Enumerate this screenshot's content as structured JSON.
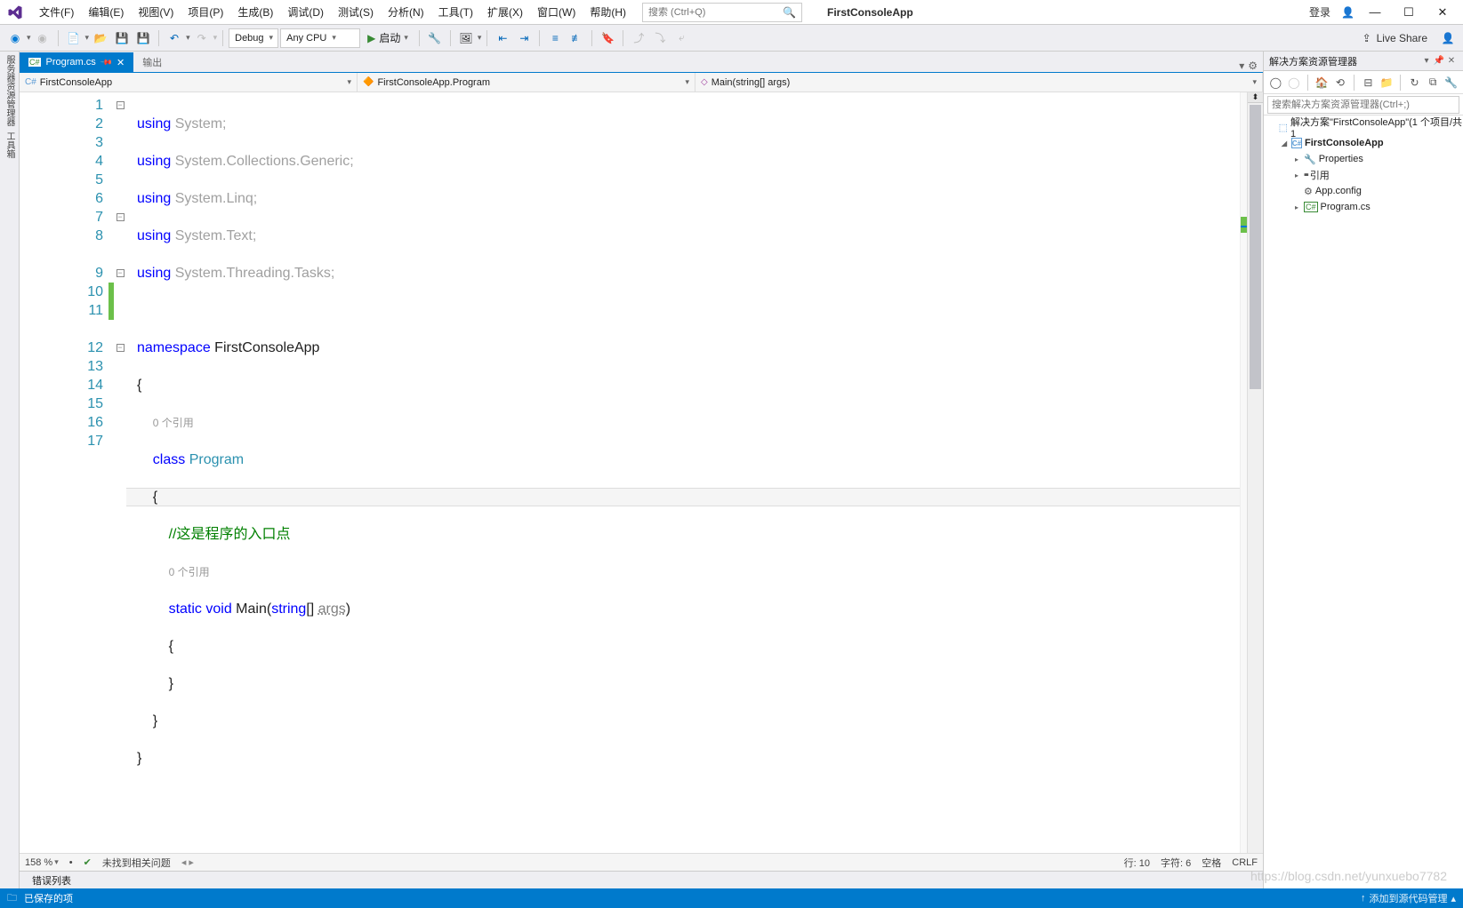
{
  "menubar": {
    "items": [
      "文件(F)",
      "编辑(E)",
      "视图(V)",
      "项目(P)",
      "生成(B)",
      "调试(D)",
      "测试(S)",
      "分析(N)",
      "工具(T)",
      "扩展(X)",
      "窗口(W)",
      "帮助(H)"
    ],
    "search_placeholder": "搜索 (Ctrl+Q)",
    "app_title": "FirstConsoleApp",
    "login": "登录"
  },
  "toolbar": {
    "config": "Debug",
    "platform": "Any CPU",
    "start": "启动",
    "liveshare": "Live Share"
  },
  "leftrail": {
    "a": "服务器资源管理器",
    "b": "工具箱"
  },
  "doc_tabs": {
    "active": "Program.cs",
    "inactive": "输出"
  },
  "nav": {
    "project": "FirstConsoleApp",
    "class": "FirstConsoleApp.Program",
    "member": "Main(string[] args)"
  },
  "code": {
    "lines": [
      "1",
      "2",
      "3",
      "4",
      "5",
      "6",
      "7",
      "8",
      "9",
      "10",
      "11",
      "12",
      "13",
      "14",
      "15",
      "16",
      "17"
    ],
    "ref0": "0 个引用",
    "comment": "//这是程序的入口点",
    "kw_using": "using",
    "kw_namespace": "namespace",
    "kw_class": "class",
    "kw_static": "static",
    "kw_void": "void",
    "kw_string": "string",
    "ns_system": "System",
    "ns_generic": "System.Collections.Generic",
    "ns_linq": "System.Linq",
    "ns_text": "System.Text",
    "ns_tasks": "System.Threading.Tasks",
    "ns_app": "FirstConsoleApp",
    "cls_program": "Program",
    "m_main": "Main",
    "p_args": "args"
  },
  "editor_status": {
    "zoom": "158 %",
    "issues": "未找到相关问题",
    "line": "行: 10",
    "col": "字符: 6",
    "ins": "空格",
    "enc": "CRLF"
  },
  "bottom_tabs": {
    "errors": "错误列表"
  },
  "solution_explorer": {
    "title": "解决方案资源管理器",
    "search_placeholder": "搜索解决方案资源管理器(Ctrl+;)",
    "solution": "解决方案\"FirstConsoleApp\"(1 个项目/共 1",
    "project": "FirstConsoleApp",
    "properties": "Properties",
    "references": "引用",
    "appconfig": "App.config",
    "programcs": "Program.cs"
  },
  "statusbar": {
    "saved": "已保存的项",
    "source": "添加到源代码管理"
  },
  "watermark": "https://blog.csdn.net/yunxuebo7782"
}
